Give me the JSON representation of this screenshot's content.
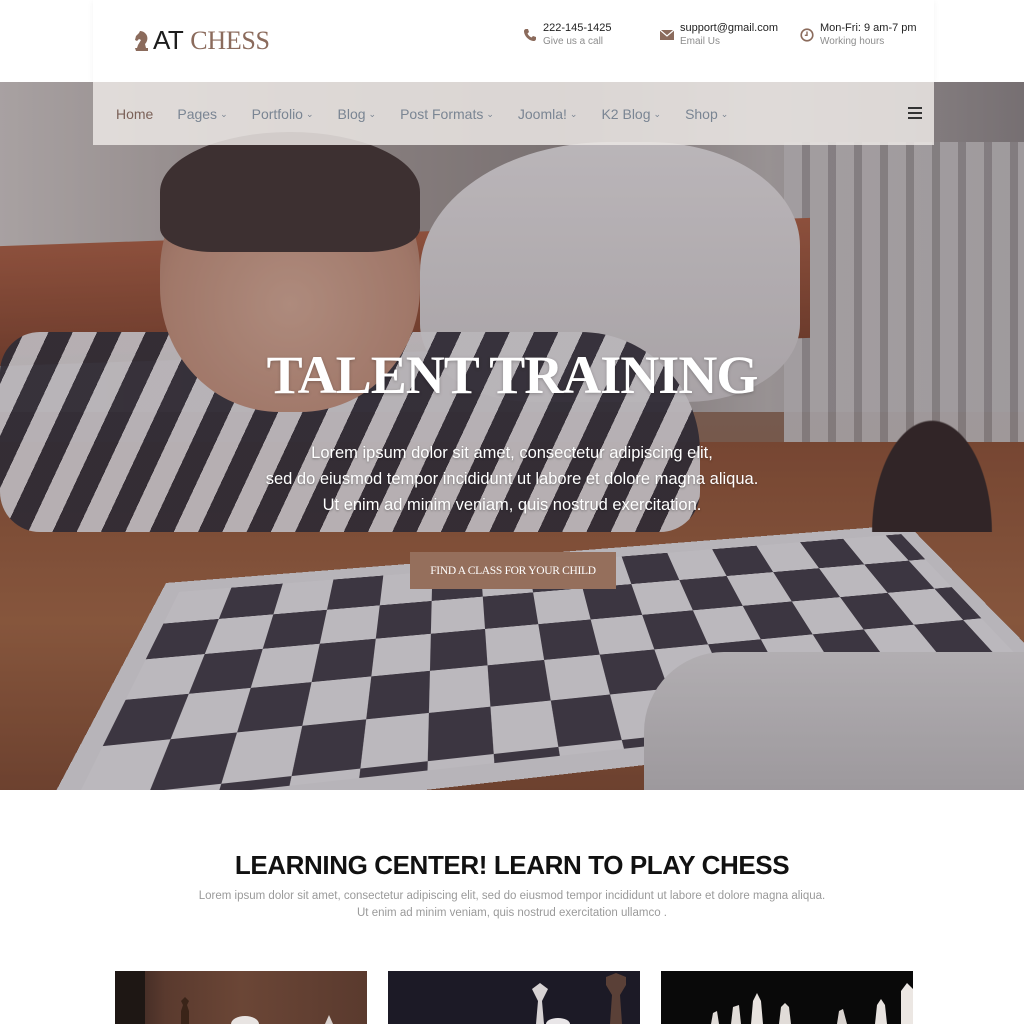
{
  "brand": {
    "name_part1": "AT",
    "name_part2": "CHESS",
    "logo_icon": "chess-knight-icon",
    "accent_color": "#8b6b5c"
  },
  "contacts": [
    {
      "icon": "phone-icon",
      "primary": "222-145-1425",
      "secondary": "Give us a call"
    },
    {
      "icon": "envelope-icon",
      "primary": "support@gmail.com",
      "secondary": "Email Us"
    },
    {
      "icon": "clock-icon",
      "primary": "Mon-Fri: 9 am-7 pm",
      "secondary": "Working hours"
    }
  ],
  "nav": {
    "items": [
      {
        "label": "Home",
        "active": true,
        "dropdown": false
      },
      {
        "label": "Pages",
        "dropdown": true
      },
      {
        "label": "Portfolio",
        "dropdown": true
      },
      {
        "label": "Blog",
        "dropdown": true
      },
      {
        "label": "Post Formats",
        "dropdown": true
      },
      {
        "label": "Joomla!",
        "dropdown": true
      },
      {
        "label": "K2 Blog",
        "dropdown": true
      },
      {
        "label": "Shop",
        "dropdown": true
      }
    ],
    "chevron": "⌄",
    "menu_icon": "hamburger-menu-icon"
  },
  "hero": {
    "title": "TALENT TRAINING",
    "text_lines": [
      "Lorem ipsum dolor sit amet, consectetur adipiscing elit,",
      "sed do eiusmod tempor incididunt ut labore et dolore magna aliqua.",
      "Ut enim ad minim veniam, quis nostrud exercitation."
    ],
    "cta_label": "FIND A CLASS FOR YOUR CHILD",
    "cta_color": "#956f5c"
  },
  "section": {
    "title": "LEARNING CENTER! LEARN TO PLAY CHESS",
    "text_lines": [
      "Lorem ipsum dolor sit amet, consectetur adipiscing elit, sed do eiusmod tempor incididunt ut labore et dolore magna aliqua.",
      "Ut enim ad minim veniam, quis nostrud exercitation ullamco ."
    ]
  },
  "cards": [
    {
      "image": "chess-pieces-brown-background"
    },
    {
      "image": "chess-king-dark-background"
    },
    {
      "image": "chess-pieces-black-background"
    }
  ]
}
